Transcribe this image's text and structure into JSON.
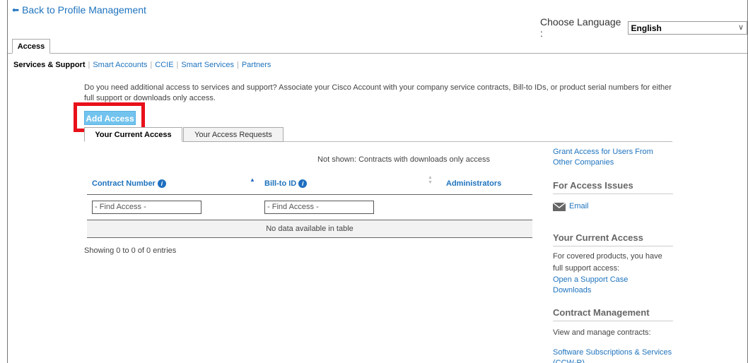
{
  "nav": {
    "back_label": "Back to Profile Management"
  },
  "language": {
    "label": "Choose Language :",
    "selected": "English"
  },
  "tabs": {
    "main": "Access"
  },
  "subnav": {
    "active": "Services & Support",
    "items": [
      "Smart Accounts",
      "CCIE",
      "Smart Services",
      "Partners"
    ]
  },
  "intro_text": "Do you need additional access to services and support? Associate your Cisco Account with your company service contracts, Bill-to IDs, or product serial numbers for either full support or downloads only access.",
  "add_access_label": "Add Access",
  "inner_tabs": {
    "current": "Your Current Access",
    "requests": "Your Access Requests"
  },
  "not_shown_text": "Not shown: Contracts with downloads only access",
  "table": {
    "columns": [
      "Contract Number",
      "Bill-to ID",
      "Administrators"
    ],
    "find_placeholder": "- Find Access -",
    "empty_text": "No data available in table",
    "showing_text": "Showing 0 to 0 of 0 entries"
  },
  "sidebar": {
    "grant_link": "Grant Access for Users From Other Companies",
    "issues_heading": "For Access Issues",
    "email_label": "Email",
    "current_heading": "Your Current Access",
    "current_text": "For covered products, you have full support access:",
    "support_case_link": "Open a Support Case",
    "downloads_link": "Downloads",
    "contract_heading": "Contract Management",
    "contract_text": "View and manage contracts:",
    "software_link": "Software Subscriptions & Services (CCW-R)"
  },
  "colors": {
    "link": "#1e73be",
    "button": "#72c3ee",
    "highlight": "#e8101a"
  }
}
